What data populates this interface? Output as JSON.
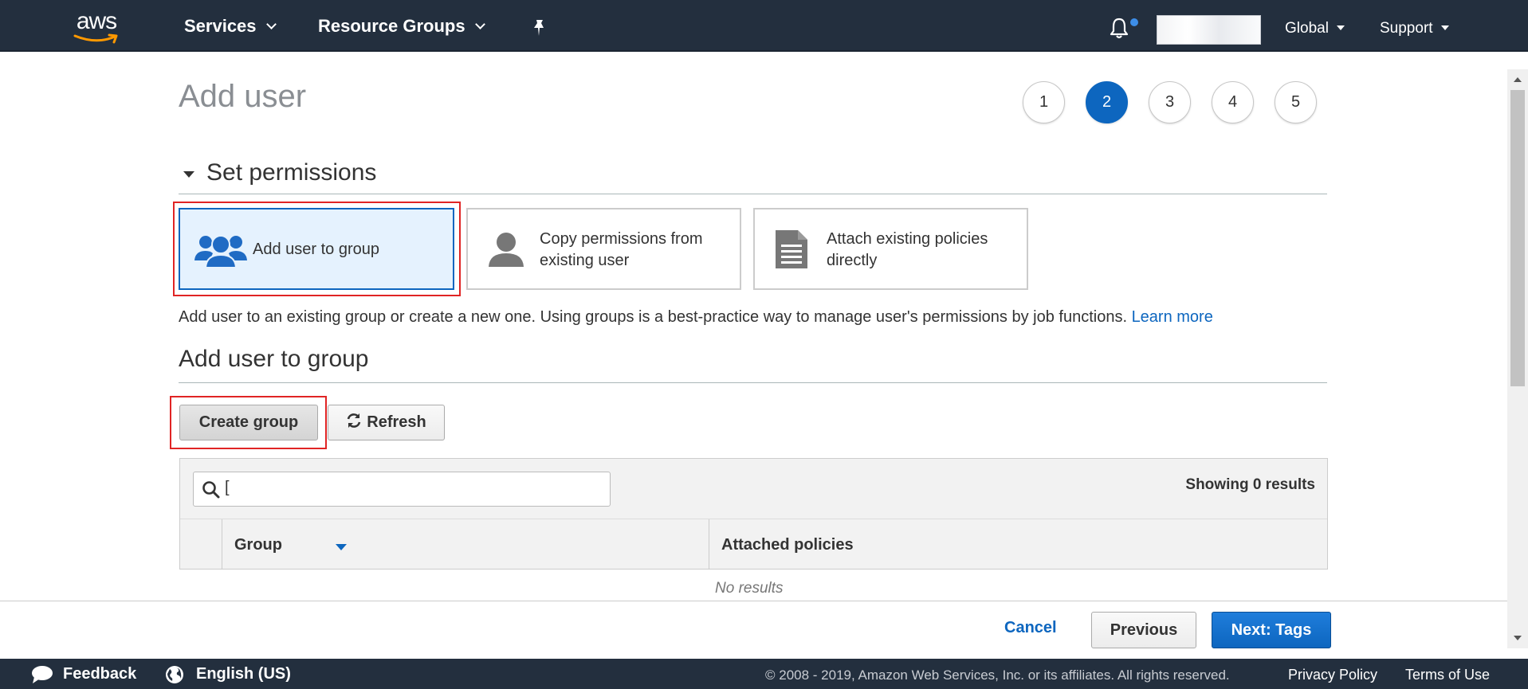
{
  "topnav": {
    "logo_text": "aws",
    "services_label": "Services",
    "resource_groups_label": "Resource Groups",
    "region_label": "Global",
    "support_label": "Support"
  },
  "page": {
    "title": "Add user",
    "steps": [
      "1",
      "2",
      "3",
      "4",
      "5"
    ],
    "active_step": "2"
  },
  "permissions": {
    "section_title": "Set permissions",
    "options": [
      {
        "label": "Add user to group",
        "icon": "group-icon",
        "selected": true
      },
      {
        "label_line1": "Copy permissions from",
        "label_line2": "existing user",
        "icon": "user-icon",
        "selected": false
      },
      {
        "label_line1": "Attach existing policies",
        "label_line2": "directly",
        "icon": "document-icon",
        "selected": false
      }
    ],
    "description": "Add user to an existing group or create a new one. Using groups is a best-practice way to manage user's permissions by job functions.",
    "learn_more": "Learn more"
  },
  "group_section": {
    "title": "Add user to group",
    "create_button": "Create group",
    "refresh_button": "Refresh",
    "search_value": "[",
    "results_count": "Showing 0 results",
    "columns": [
      "Group",
      "Attached policies"
    ],
    "empty_text": "No results"
  },
  "actions": {
    "cancel": "Cancel",
    "previous": "Previous",
    "next": "Next: Tags"
  },
  "footer": {
    "feedback": "Feedback",
    "language": "English (US)",
    "copyright": "© 2008 - 2019, Amazon Web Services, Inc. or its affiliates. All rights reserved.",
    "privacy": "Privacy Policy",
    "terms": "Terms of Use"
  },
  "colors": {
    "nav_bg": "#232f3e",
    "accent_blue": "#0d66bf",
    "highlight_red": "#e02424",
    "selected_bg": "#e5f2fe"
  }
}
